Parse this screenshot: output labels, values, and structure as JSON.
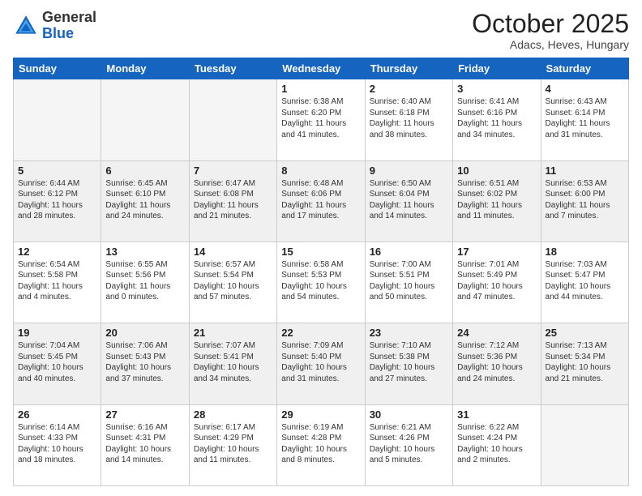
{
  "header": {
    "logo_general": "General",
    "logo_blue": "Blue",
    "month_title": "October 2025",
    "location": "Adacs, Heves, Hungary"
  },
  "days_of_week": [
    "Sunday",
    "Monday",
    "Tuesday",
    "Wednesday",
    "Thursday",
    "Friday",
    "Saturday"
  ],
  "weeks": [
    [
      {
        "day": "",
        "info": ""
      },
      {
        "day": "",
        "info": ""
      },
      {
        "day": "",
        "info": ""
      },
      {
        "day": "1",
        "info": "Sunrise: 6:38 AM\nSunset: 6:20 PM\nDaylight: 11 hours\nand 41 minutes."
      },
      {
        "day": "2",
        "info": "Sunrise: 6:40 AM\nSunset: 6:18 PM\nDaylight: 11 hours\nand 38 minutes."
      },
      {
        "day": "3",
        "info": "Sunrise: 6:41 AM\nSunset: 6:16 PM\nDaylight: 11 hours\nand 34 minutes."
      },
      {
        "day": "4",
        "info": "Sunrise: 6:43 AM\nSunset: 6:14 PM\nDaylight: 11 hours\nand 31 minutes."
      }
    ],
    [
      {
        "day": "5",
        "info": "Sunrise: 6:44 AM\nSunset: 6:12 PM\nDaylight: 11 hours\nand 28 minutes."
      },
      {
        "day": "6",
        "info": "Sunrise: 6:45 AM\nSunset: 6:10 PM\nDaylight: 11 hours\nand 24 minutes."
      },
      {
        "day": "7",
        "info": "Sunrise: 6:47 AM\nSunset: 6:08 PM\nDaylight: 11 hours\nand 21 minutes."
      },
      {
        "day": "8",
        "info": "Sunrise: 6:48 AM\nSunset: 6:06 PM\nDaylight: 11 hours\nand 17 minutes."
      },
      {
        "day": "9",
        "info": "Sunrise: 6:50 AM\nSunset: 6:04 PM\nDaylight: 11 hours\nand 14 minutes."
      },
      {
        "day": "10",
        "info": "Sunrise: 6:51 AM\nSunset: 6:02 PM\nDaylight: 11 hours\nand 11 minutes."
      },
      {
        "day": "11",
        "info": "Sunrise: 6:53 AM\nSunset: 6:00 PM\nDaylight: 11 hours\nand 7 minutes."
      }
    ],
    [
      {
        "day": "12",
        "info": "Sunrise: 6:54 AM\nSunset: 5:58 PM\nDaylight: 11 hours\nand 4 minutes."
      },
      {
        "day": "13",
        "info": "Sunrise: 6:55 AM\nSunset: 5:56 PM\nDaylight: 11 hours\nand 0 minutes."
      },
      {
        "day": "14",
        "info": "Sunrise: 6:57 AM\nSunset: 5:54 PM\nDaylight: 10 hours\nand 57 minutes."
      },
      {
        "day": "15",
        "info": "Sunrise: 6:58 AM\nSunset: 5:53 PM\nDaylight: 10 hours\nand 54 minutes."
      },
      {
        "day": "16",
        "info": "Sunrise: 7:00 AM\nSunset: 5:51 PM\nDaylight: 10 hours\nand 50 minutes."
      },
      {
        "day": "17",
        "info": "Sunrise: 7:01 AM\nSunset: 5:49 PM\nDaylight: 10 hours\nand 47 minutes."
      },
      {
        "day": "18",
        "info": "Sunrise: 7:03 AM\nSunset: 5:47 PM\nDaylight: 10 hours\nand 44 minutes."
      }
    ],
    [
      {
        "day": "19",
        "info": "Sunrise: 7:04 AM\nSunset: 5:45 PM\nDaylight: 10 hours\nand 40 minutes."
      },
      {
        "day": "20",
        "info": "Sunrise: 7:06 AM\nSunset: 5:43 PM\nDaylight: 10 hours\nand 37 minutes."
      },
      {
        "day": "21",
        "info": "Sunrise: 7:07 AM\nSunset: 5:41 PM\nDaylight: 10 hours\nand 34 minutes."
      },
      {
        "day": "22",
        "info": "Sunrise: 7:09 AM\nSunset: 5:40 PM\nDaylight: 10 hours\nand 31 minutes."
      },
      {
        "day": "23",
        "info": "Sunrise: 7:10 AM\nSunset: 5:38 PM\nDaylight: 10 hours\nand 27 minutes."
      },
      {
        "day": "24",
        "info": "Sunrise: 7:12 AM\nSunset: 5:36 PM\nDaylight: 10 hours\nand 24 minutes."
      },
      {
        "day": "25",
        "info": "Sunrise: 7:13 AM\nSunset: 5:34 PM\nDaylight: 10 hours\nand 21 minutes."
      }
    ],
    [
      {
        "day": "26",
        "info": "Sunrise: 6:14 AM\nSunset: 4:33 PM\nDaylight: 10 hours\nand 18 minutes."
      },
      {
        "day": "27",
        "info": "Sunrise: 6:16 AM\nSunset: 4:31 PM\nDaylight: 10 hours\nand 14 minutes."
      },
      {
        "day": "28",
        "info": "Sunrise: 6:17 AM\nSunset: 4:29 PM\nDaylight: 10 hours\nand 11 minutes."
      },
      {
        "day": "29",
        "info": "Sunrise: 6:19 AM\nSunset: 4:28 PM\nDaylight: 10 hours\nand 8 minutes."
      },
      {
        "day": "30",
        "info": "Sunrise: 6:21 AM\nSunset: 4:26 PM\nDaylight: 10 hours\nand 5 minutes."
      },
      {
        "day": "31",
        "info": "Sunrise: 6:22 AM\nSunset: 4:24 PM\nDaylight: 10 hours\nand 2 minutes."
      },
      {
        "day": "",
        "info": ""
      }
    ]
  ]
}
